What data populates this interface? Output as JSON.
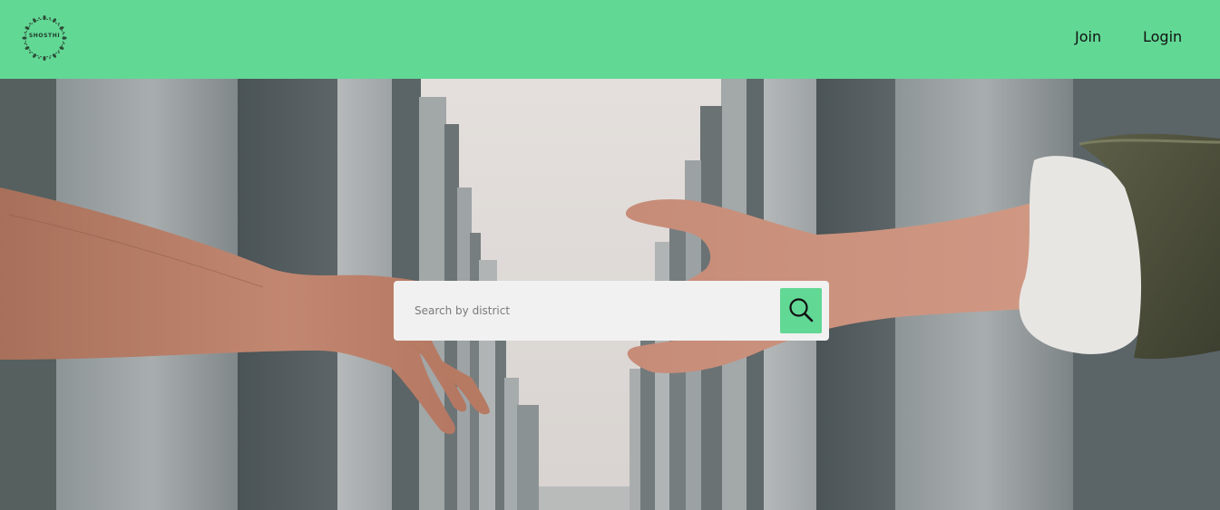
{
  "header": {
    "logo_text": "SHOSTHI",
    "nav": {
      "join_label": "Join",
      "login_label": "Login"
    }
  },
  "hero": {
    "image_description_icon": "hands-reaching-photo"
  },
  "search": {
    "placeholder": "Search by district",
    "value": "",
    "button_icon": "search-icon"
  },
  "colors": {
    "brand_green": "#62d895",
    "search_bg": "#f1f1f1",
    "text_dark": "#111111"
  }
}
